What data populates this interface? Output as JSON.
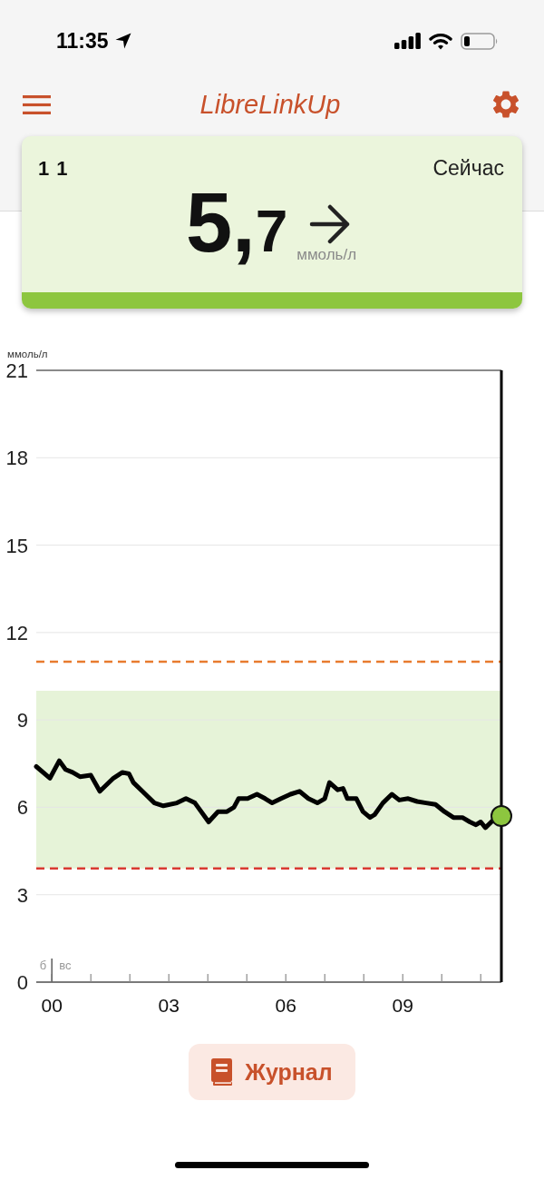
{
  "status_bar": {
    "time": "11:35"
  },
  "header": {
    "title": "LibreLinkUp"
  },
  "reading_card": {
    "sensor_label": "1 1",
    "time_label": "Сейчас",
    "value": "5,7",
    "unit": "ммоль/л"
  },
  "chart": {
    "day_labels": {
      "before": "б",
      "after": "вс"
    },
    "chart_data": {
      "type": "line",
      "ylabel": "ммоль/л",
      "grid": true,
      "x": [
        -0.4,
        -0.05,
        0.19,
        0.35,
        0.53,
        0.72,
        1.0,
        1.23,
        1.58,
        1.81,
        1.98,
        2.09,
        2.4,
        2.63,
        2.86,
        3.21,
        3.44,
        3.67,
        4.02,
        4.26,
        4.49,
        4.67,
        4.79,
        5.02,
        5.26,
        5.47,
        5.65,
        5.88,
        6.12,
        6.35,
        6.58,
        6.81,
        7.0,
        7.12,
        7.33,
        7.47,
        7.58,
        7.81,
        7.98,
        8.16,
        8.28,
        8.49,
        8.72,
        8.91,
        9.14,
        9.37,
        9.6,
        9.84,
        10.07,
        10.3,
        10.53,
        10.72,
        10.88,
        11.0,
        11.12,
        11.35,
        11.53
      ],
      "series": [
        {
          "color": "#000000",
          "values": [
            7.4,
            7.0,
            7.6,
            7.3,
            7.2,
            7.05,
            7.1,
            6.55,
            7.0,
            7.2,
            7.15,
            6.85,
            6.45,
            6.15,
            6.05,
            6.15,
            6.3,
            6.15,
            5.5,
            5.85,
            5.85,
            6.0,
            6.3,
            6.3,
            6.45,
            6.3,
            6.15,
            6.3,
            6.45,
            6.55,
            6.3,
            6.15,
            6.3,
            6.85,
            6.6,
            6.65,
            6.3,
            6.3,
            5.85,
            5.65,
            5.75,
            6.15,
            6.45,
            6.25,
            6.3,
            6.2,
            6.15,
            6.1,
            5.85,
            5.65,
            5.65,
            5.5,
            5.4,
            5.5,
            5.3,
            5.6,
            5.7
          ]
        }
      ],
      "xlim": [
        -0.4,
        11.53
      ],
      "ylim": [
        0,
        21
      ],
      "xticks": [
        {
          "value": 0,
          "label": "00"
        },
        {
          "value": 3,
          "label": "03"
        },
        {
          "value": 6,
          "label": "06"
        },
        {
          "value": 9,
          "label": "09"
        }
      ],
      "yticks": [
        0,
        3,
        6,
        9,
        12,
        15,
        18,
        21
      ],
      "bands": [
        {
          "axis": "y",
          "from": 3.9,
          "to": 10,
          "color": "#e6f3d8"
        }
      ],
      "ref_lines": [
        {
          "axis": "y",
          "value": 11,
          "color": "#e87b2e"
        },
        {
          "axis": "y",
          "value": 3.9,
          "color": "#d93a32"
        },
        {
          "axis": "x",
          "value": 11.53,
          "color": "#000000"
        }
      ]
    }
  },
  "journal_button": {
    "label": "Журнал"
  }
}
